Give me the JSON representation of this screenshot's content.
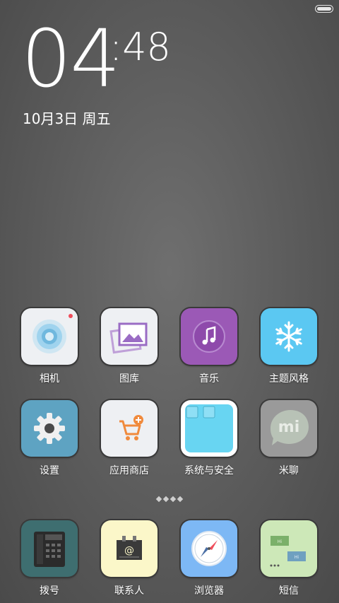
{
  "status": {
    "battery_icon": "battery-icon"
  },
  "clock": {
    "hours": "04",
    "minutes": "48",
    "colon": ":",
    "date": "10月3日 周五"
  },
  "apps_row1": [
    {
      "label": "相机",
      "icon": "camera-icon",
      "color": "#eef0f3"
    },
    {
      "label": "图库",
      "icon": "gallery-icon",
      "color": "#eef0f3"
    },
    {
      "label": "音乐",
      "icon": "music-icon",
      "color": "#9b59b6"
    },
    {
      "label": "主题风格",
      "icon": "snowflake-icon",
      "color": "#5bc8f2"
    }
  ],
  "apps_row2": [
    {
      "label": "设置",
      "icon": "gear-icon",
      "color": "#5ea3c2"
    },
    {
      "label": "应用商店",
      "icon": "shopping-cart-icon",
      "color": "#eef0f3"
    },
    {
      "label": "系统与安全",
      "icon": "folder-icon",
      "color": "#68d5f2"
    },
    {
      "label": "米聊",
      "icon": "mi-chat-icon",
      "color": "#9a9a9a"
    }
  ],
  "page_indicator": {
    "count": 4
  },
  "dock": [
    {
      "label": "拨号",
      "icon": "phone-icon",
      "color": "#3e6e70"
    },
    {
      "label": "联系人",
      "icon": "contacts-icon",
      "color": "#fbf7c9"
    },
    {
      "label": "浏览器",
      "icon": "compass-icon",
      "color": "#7db8f5"
    },
    {
      "label": "短信",
      "icon": "sms-icon",
      "color": "#cde8b8"
    }
  ]
}
